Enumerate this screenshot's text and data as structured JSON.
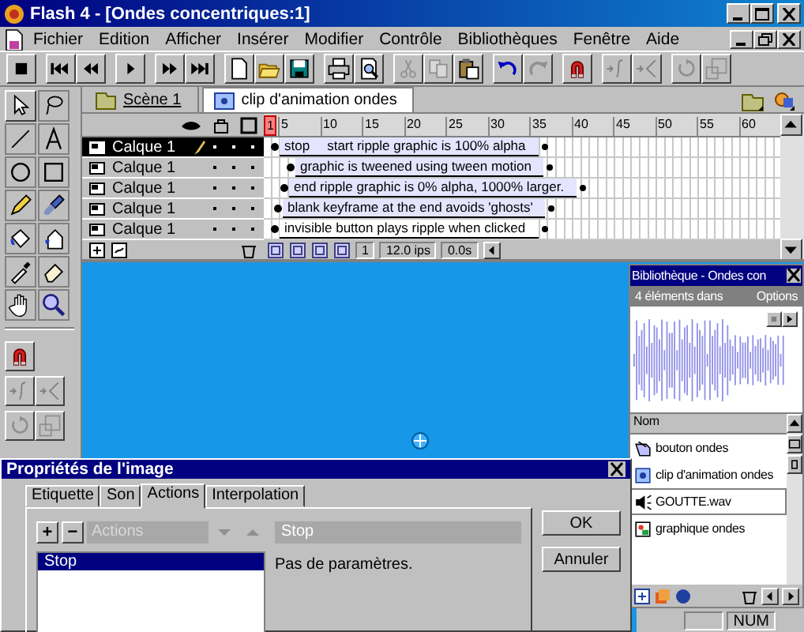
{
  "window": {
    "title": "Flash 4 - [Ondes concentriques:1]"
  },
  "menu": [
    "Fichier",
    "Edition",
    "Afficher",
    "Insérer",
    "Modifier",
    "Contrôle",
    "Bibliothèques",
    "Fenêtre",
    "Aide"
  ],
  "scenes": [
    {
      "label": "Scène 1",
      "selected": false
    },
    {
      "label": "clip d'animation ondes",
      "selected": true
    }
  ],
  "timeline": {
    "playhead": "1",
    "ruler": [
      "5",
      "10",
      "15",
      "20",
      "25",
      "30",
      "35",
      "40",
      "45",
      "50",
      "55",
      "60"
    ],
    "layers": [
      {
        "name": "Calque 1",
        "selected": true,
        "tweened": true,
        "labels": [
          "stop",
          "start ripple graphic is 100% alpha"
        ]
      },
      {
        "name": "Calque 1",
        "selected": false,
        "tweened": true,
        "labels": [
          "graphic is tweened using tween motion"
        ]
      },
      {
        "name": "Calque 1",
        "selected": false,
        "tweened": true,
        "labels": [
          "end ripple graphic is 0% alpha, 1000% larger."
        ]
      },
      {
        "name": "Calque 1",
        "selected": false,
        "tweened": true,
        "labels": [
          "blank keyframe at the end avoids 'ghosts'"
        ]
      },
      {
        "name": "Calque 1",
        "selected": false,
        "tweened": false,
        "labels": [
          "invisible button plays ripple when clicked"
        ]
      }
    ],
    "frame": "1",
    "rate": "12.0 ips",
    "time": "0.0s"
  },
  "library": {
    "title": "Bibliothèque - Ondes con",
    "count": "4 éléments dans",
    "options": "Options",
    "column": "Nom",
    "items": [
      {
        "name": "bouton ondes",
        "kind": "button",
        "selected": false
      },
      {
        "name": "clip d'animation ondes",
        "kind": "movieclip",
        "selected": false
      },
      {
        "name": "GOUTTE.wav",
        "kind": "sound",
        "selected": true
      },
      {
        "name": "graphique ondes",
        "kind": "graphic",
        "selected": false
      }
    ]
  },
  "dialog": {
    "title": "Propriétés de l'image",
    "tabs": [
      {
        "label": "Etiquette",
        "selected": false
      },
      {
        "label": "Son",
        "selected": false
      },
      {
        "label": "Actions",
        "selected": true
      },
      {
        "label": "Interpolation",
        "selected": false
      }
    ],
    "add": "+",
    "remove": "−",
    "dropdown": {
      "label": "Actions",
      "disabled": true
    },
    "actions": [
      {
        "label": "Stop",
        "selected": true
      }
    ],
    "detail_title": "Stop",
    "detail_text": "Pas de paramètres.",
    "buttons": [
      "OK",
      "Annuler"
    ]
  },
  "status": "NUM"
}
